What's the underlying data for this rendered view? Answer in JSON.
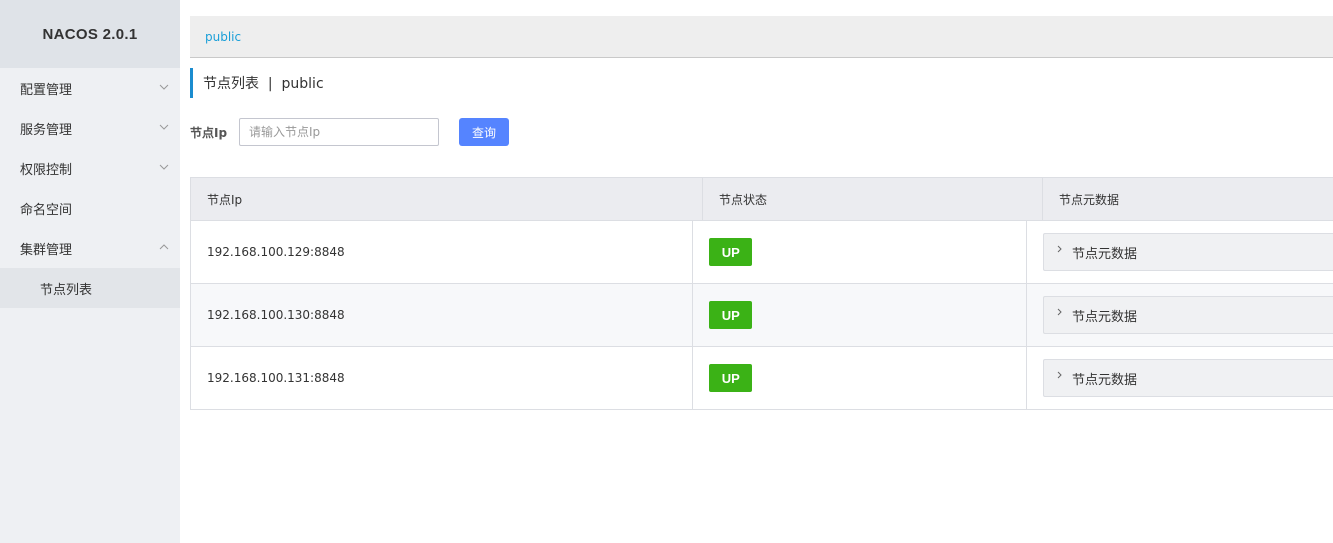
{
  "brand": {
    "title": "NACOS 2.0.1"
  },
  "sidebar": {
    "items": [
      {
        "label": "配置管理",
        "chevron": "down"
      },
      {
        "label": "服务管理",
        "chevron": "down"
      },
      {
        "label": "权限控制",
        "chevron": "down"
      },
      {
        "label": "命名空间",
        "chevron": ""
      },
      {
        "label": "集群管理",
        "chevron": "up"
      }
    ],
    "sub_items": [
      {
        "label": "节点列表"
      }
    ]
  },
  "breadcrumb": {
    "namespace": "public"
  },
  "page": {
    "title": "节点列表  |  public"
  },
  "search": {
    "label": "节点Ip",
    "placeholder": "请输入节点Ip",
    "button": "查询"
  },
  "table": {
    "headers": [
      "节点Ip",
      "节点状态",
      "节点元数据"
    ],
    "rows": [
      {
        "ip": "192.168.100.129:8848",
        "state": "UP",
        "meta": "节点元数据"
      },
      {
        "ip": "192.168.100.130:8848",
        "state": "UP",
        "meta": "节点元数据"
      },
      {
        "ip": "192.168.100.131:8848",
        "state": "UP",
        "meta": "节点元数据"
      }
    ]
  },
  "colors": {
    "accent": "#5584ff",
    "status_up": "#3bb216",
    "link": "#1a9fd8",
    "sidebar_bg": "#eef0f3"
  },
  "icons": {
    "collapsed": "chevron-down-icon",
    "expanded": "chevron-up-icon",
    "expand_row": "chevron-right-icon"
  }
}
